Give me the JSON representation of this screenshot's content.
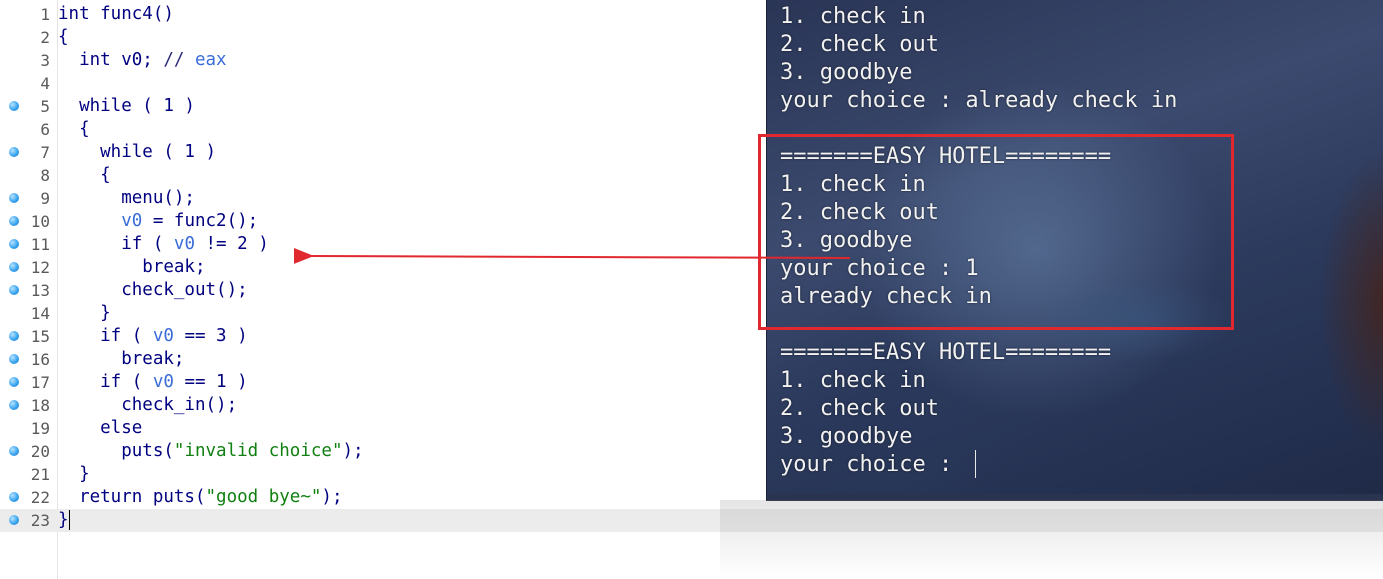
{
  "editor": {
    "lines": [
      {
        "n": "1",
        "bp": false,
        "html": "int func4()"
      },
      {
        "n": "2",
        "bp": false,
        "html": "{"
      },
      {
        "n": "3",
        "bp": false,
        "html": "  int v0; <span class=\"cmt\">// <span class=\"var\">eax</span></span>"
      },
      {
        "n": "4",
        "bp": false,
        "html": ""
      },
      {
        "n": "5",
        "bp": true,
        "html": "  while ( 1 )"
      },
      {
        "n": "6",
        "bp": false,
        "html": "  {"
      },
      {
        "n": "7",
        "bp": true,
        "html": "    while ( 1 )"
      },
      {
        "n": "8",
        "bp": false,
        "html": "    {"
      },
      {
        "n": "9",
        "bp": true,
        "html": "      menu();"
      },
      {
        "n": "10",
        "bp": true,
        "html": "      <span class=\"var\">v0</span> = func2();"
      },
      {
        "n": "11",
        "bp": true,
        "html": "      if ( <span class=\"var\">v0</span> != 2 )"
      },
      {
        "n": "12",
        "bp": true,
        "html": "        break;"
      },
      {
        "n": "13",
        "bp": true,
        "html": "      check_out();"
      },
      {
        "n": "14",
        "bp": false,
        "html": "    }"
      },
      {
        "n": "15",
        "bp": true,
        "html": "    if ( <span class=\"var\">v0</span> == 3 )"
      },
      {
        "n": "16",
        "bp": true,
        "html": "      break;"
      },
      {
        "n": "17",
        "bp": true,
        "html": "    if ( <span class=\"var\">v0</span> == 1 )"
      },
      {
        "n": "18",
        "bp": true,
        "html": "      check_in();"
      },
      {
        "n": "19",
        "bp": false,
        "html": "    else"
      },
      {
        "n": "20",
        "bp": true,
        "html": "      puts(<span class=\"str\">\"invalid choice\"</span>);"
      },
      {
        "n": "21",
        "bp": false,
        "html": "  }"
      },
      {
        "n": "22",
        "bp": true,
        "html": "  return puts(<span class=\"str\">\"good bye~\"</span>);"
      },
      {
        "n": "23",
        "bp": true,
        "html": "}"
      }
    ],
    "current_line": 23
  },
  "terminal": {
    "lines": [
      "1. check in",
      "2. check out",
      "3. goodbye",
      "your choice : already check in",
      "",
      "=======EASY HOTEL========",
      "1. check in",
      "2. check out",
      "3. goodbye",
      "your choice : 1",
      "already check in",
      "",
      "=======EASY HOTEL========",
      "1. check in",
      "2. check out",
      "3. goodbye",
      "your choice : "
    ]
  },
  "annotation": {
    "box_color": "#e0282e",
    "arrow_color": "#e0282e"
  }
}
